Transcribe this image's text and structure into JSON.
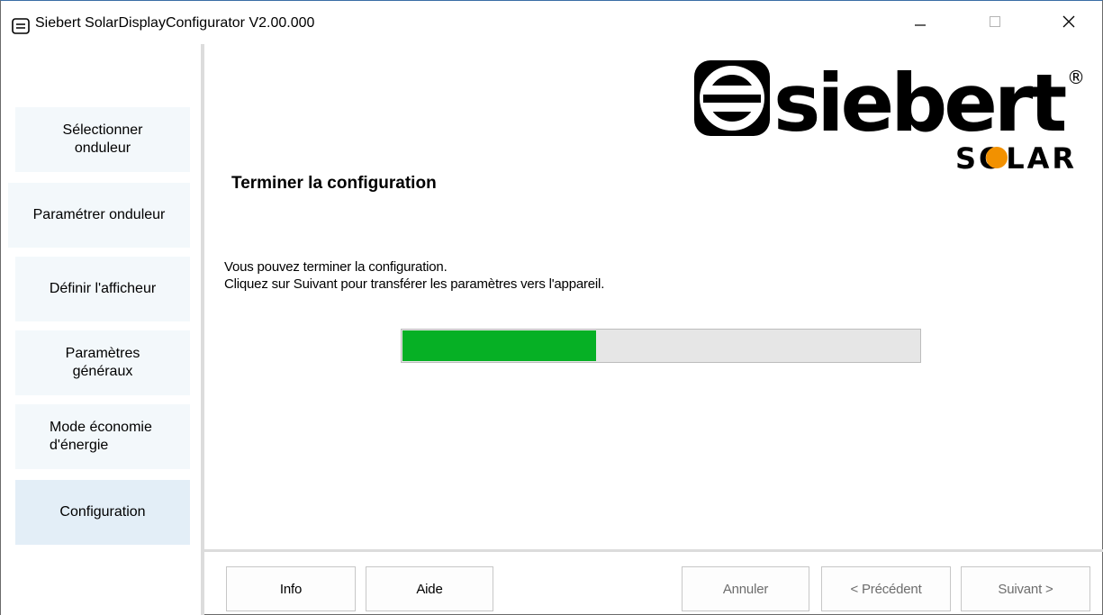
{
  "window": {
    "title": "Siebert SolarDisplayConfigurator V2.00.000"
  },
  "sidebar": {
    "items": [
      {
        "label": "Sélectionner\nonduleur",
        "active": false
      },
      {
        "label": "Paramétrer onduleur",
        "active": false
      },
      {
        "label": "Définir l'afficheur",
        "active": false
      },
      {
        "label": "Paramètres\ngénéraux",
        "active": false
      },
      {
        "label": "Mode économie\nd'énergie",
        "active": false
      },
      {
        "label": "Configuration",
        "active": true
      }
    ]
  },
  "logo": {
    "brand": "siebert",
    "sub": "SOLAR",
    "registered": "®"
  },
  "main": {
    "title": "Terminer la configuration",
    "message_line1": "Vous pouvez terminer la configuration.",
    "message_line2": "Cliquez sur Suivant pour transférer les paramètres vers l'appareil.",
    "progress": 0.375
  },
  "buttons": {
    "info": "Info",
    "aide": "Aide",
    "annuler": "Annuler",
    "precedent": "< Précédent",
    "suivant": "Suivant >"
  },
  "colors": {
    "progress_fill": "#06b025",
    "logo_accent": "#f29100",
    "sidebar_bg": "#f3f8fb"
  }
}
